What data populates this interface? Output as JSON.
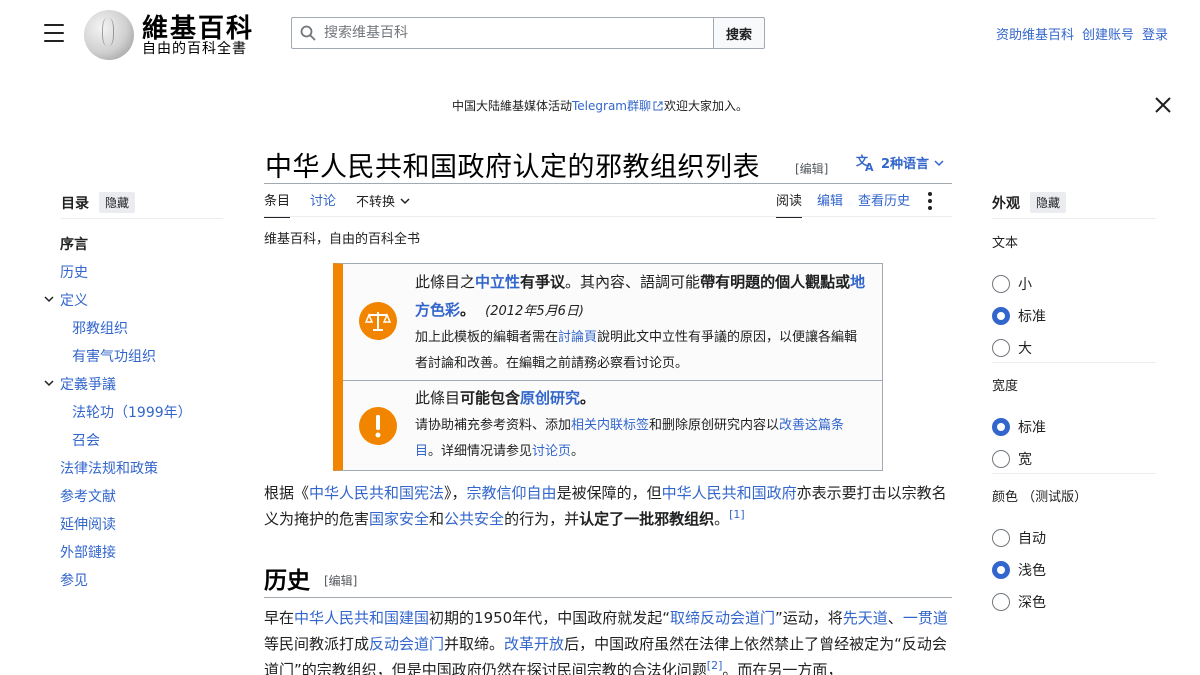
{
  "header": {
    "logo_title": "維基百科",
    "logo_tagline": "自由的百科全書",
    "search_placeholder": "搜索维基百科",
    "search_button": "搜索",
    "user_links": [
      "资助维基百科",
      "创建账号",
      "登录"
    ]
  },
  "banner": {
    "before": "中国大陆維基媒体活动",
    "link": "Telegram群聊",
    "after": "欢迎大家加入。"
  },
  "title": {
    "text": "中华人民共和国政府认定的邪教组织列表",
    "edit": "[编辑]",
    "languages": "2种语言"
  },
  "tabs": {
    "left": [
      "条目",
      "讨论",
      "不转换"
    ],
    "right": [
      "阅读",
      "编辑",
      "查看历史"
    ]
  },
  "sitesub": "维基百科，自由的百科全书",
  "toc": {
    "heading": "目录",
    "hide": "隐藏",
    "items": [
      {
        "label": "序言",
        "level": 1,
        "current": true,
        "chevron": false
      },
      {
        "label": "历史",
        "level": 1,
        "current": false,
        "chevron": false
      },
      {
        "label": "定义",
        "level": 1,
        "current": false,
        "chevron": true
      },
      {
        "label": "邪教组织",
        "level": 2,
        "current": false,
        "chevron": false
      },
      {
        "label": "有害气功组织",
        "level": 2,
        "current": false,
        "chevron": false
      },
      {
        "label": "定義爭議",
        "level": 1,
        "current": false,
        "chevron": true
      },
      {
        "label": "法轮功（1999年）",
        "level": 2,
        "current": false,
        "chevron": false
      },
      {
        "label": "召会",
        "level": 2,
        "current": false,
        "chevron": false
      },
      {
        "label": "法律法规和政策",
        "level": 1,
        "current": false,
        "chevron": false
      },
      {
        "label": "参考文献",
        "level": 1,
        "current": false,
        "chevron": false
      },
      {
        "label": "延伸阅读",
        "level": 1,
        "current": false,
        "chevron": false
      },
      {
        "label": "外部鏈接",
        "level": 1,
        "current": false,
        "chevron": false
      },
      {
        "label": "参见",
        "level": 1,
        "current": false,
        "chevron": false
      }
    ]
  },
  "appearance": {
    "heading": "外观",
    "hide": "隐藏",
    "text_label": "文本",
    "text_options": [
      {
        "label": "小",
        "on": false
      },
      {
        "label": "标准",
        "on": true
      },
      {
        "label": "大",
        "on": false
      }
    ],
    "width_label": "宽度",
    "width_options": [
      {
        "label": "标准",
        "on": true
      },
      {
        "label": "宽",
        "on": false
      }
    ],
    "color_label": "颜色 （测试版）",
    "color_options": [
      {
        "label": "自动",
        "on": false
      },
      {
        "label": "浅色",
        "on": true
      },
      {
        "label": "深色",
        "on": false
      }
    ]
  },
  "ambox1": {
    "t1": "此條目之",
    "l1": "中立性",
    "t2": "有爭议",
    "t3": "。其內容、語調可能",
    "t4": "帶有明題的個人觀點",
    "t5": "或",
    "l2": "地方色彩",
    "t6": "。",
    "date": "(2012年5月6日)",
    "s1": "加上此模板的編輯者需在",
    "l3": "討論頁",
    "s2": "說明此文中立性有爭議的原因，以便讓各編輯者討論和改善。在編輯之前請務必察看讨论页。"
  },
  "ambox2": {
    "t1": "此條目",
    "t2": "可能包含",
    "l1": "原创研究",
    "t3": "。",
    "s1": "请协助補充参考资料、添加",
    "l2": "相关内联标签",
    "s2": "和删除原创研究内容以",
    "l3": "改善这篇条目",
    "s3": "。详细情况请参见",
    "l4": "讨论页",
    "s4": "。"
  },
  "para1": {
    "a": "根据《",
    "l1": "中华人民共和国宪法",
    "b": "》，",
    "l2": "宗教信仰自由",
    "c": "是被保障的，但",
    "l3": "中华人民共和国政府",
    "d": "亦表示要打击以宗教名义为掩护的危害",
    "l4": "国家安全",
    "e": "和",
    "l5": "公共安全",
    "f": "的行为，并",
    "bold": "认定了一批邪教组织",
    "g": "。",
    "ref": "[1]"
  },
  "section_history": {
    "title": "历史",
    "edit": "[编辑]"
  },
  "para2": {
    "a": "早在",
    "l1": "中华人民共和国建国",
    "b": "初期的1950年代，中国政府就发起“",
    "l2": "取缔反动会道门",
    "c": "”运动，将",
    "l3": "先天道",
    "d": "、",
    "l4": "一贯道",
    "e": "等民间教派打成",
    "l5": "反动会道门",
    "f": "并取缔。",
    "l6": "改革开放",
    "g": "后，中国政府虽然在法律上依然禁止了曾经被定为“反动会道门”的宗教组织，但是中国政府仍然在探讨民间宗教的合法化问题",
    "ref": "[2]",
    "h": "。而在另一方面，"
  }
}
